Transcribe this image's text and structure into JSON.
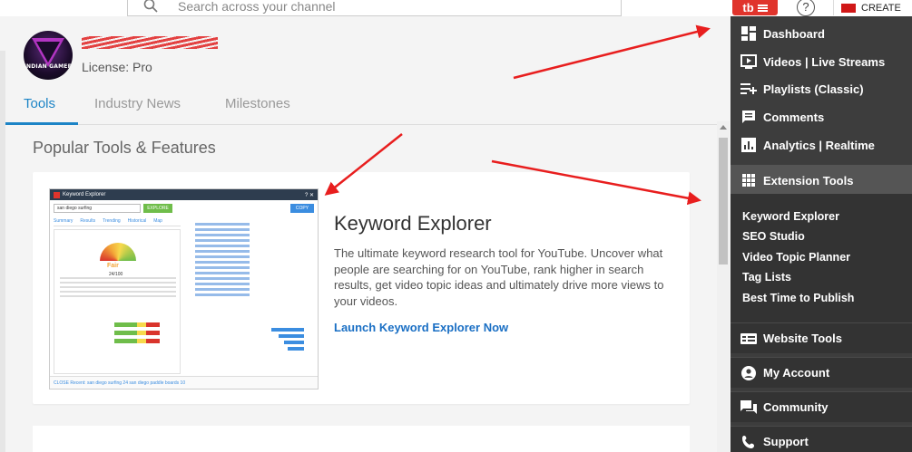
{
  "topbar": {
    "search_placeholder": "Search across your channel",
    "help_label": "?",
    "create_label": "CREATE",
    "badge_label": "tb"
  },
  "profile": {
    "avatar_text": "INDIAN GAMER",
    "license": "License: Pro"
  },
  "tabs": [
    {
      "label": "Tools",
      "active": true
    },
    {
      "label": "Industry News",
      "active": false
    },
    {
      "label": "Milestones",
      "active": false
    }
  ],
  "main": {
    "section_title": "Popular Tools & Features",
    "card": {
      "title": "Keyword Explorer",
      "description": "The ultimate keyword research tool for YouTube. Uncover what people are searching for on YouTube, rank higher in search results, get video topic ideas and ultimately drive more views to your videos.",
      "link": "Launch Keyword Explorer Now"
    },
    "preview": {
      "header": "Keyword Explorer",
      "query": "san diego surfing",
      "explore": "EXPLORE",
      "copy": "COPY",
      "tabs": [
        "Summary",
        "Results",
        "Trending",
        "Historical",
        "Map"
      ],
      "score_label": "Fair",
      "score_value": "24/100",
      "footer": "CLOSE   Recent: san diego surfing  24  san diego paddle boards  10"
    }
  },
  "menu": {
    "items": [
      {
        "label": "Dashboard",
        "icon": "dashboard-icon"
      },
      {
        "label": "Videos  |  Live Streams",
        "icon": "video-icon"
      },
      {
        "label": "Playlists (Classic)",
        "icon": "playlist-icon"
      },
      {
        "label": "Comments",
        "icon": "comment-icon"
      },
      {
        "label": "Analytics  |  Realtime",
        "icon": "analytics-icon"
      },
      {
        "label": "Extension Tools",
        "icon": "grid-icon"
      },
      {
        "label": "Website Tools",
        "icon": "website-icon"
      },
      {
        "label": "My Account",
        "icon": "account-icon"
      },
      {
        "label": "Community",
        "icon": "community-icon"
      },
      {
        "label": "Support",
        "icon": "support-icon"
      }
    ],
    "extension_subitems": [
      "Keyword Explorer",
      "SEO Studio",
      "Video Topic Planner",
      "Tag Lists",
      "Best Time to Publish"
    ]
  },
  "colors": {
    "accent": "#1c84c6",
    "menu_bg": "#3d3d3d",
    "brand_red": "#e0342c",
    "annotation_arrow": "#e81e1e"
  }
}
